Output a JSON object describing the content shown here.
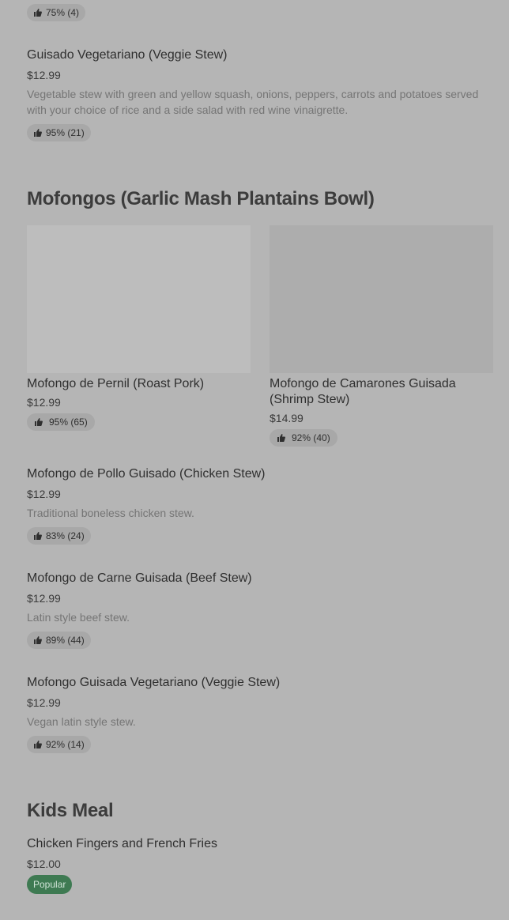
{
  "items": {
    "prev_item": {
      "rating": "75% (4)"
    },
    "guisado_vegetariano": {
      "title": "Guisado Vegetariano (Veggie Stew)",
      "price": "$12.99",
      "description": "Vegetable stew with green and yellow squash, onions, peppers, carrots and potatoes served with your choice of rice and a side salad with red wine vinaigrette.",
      "rating": "95% (21)"
    }
  },
  "mofongos": {
    "heading": "Mofongos (Garlic Mash Plantains Bowl)",
    "cards": [
      {
        "title": "Mofongo de Pernil (Roast Pork)",
        "price": "$12.99",
        "rating": "95% (65)"
      },
      {
        "title": "Mofongo de Camarones Guisada (Shrimp Stew)",
        "price": "$14.99",
        "rating": "92% (40)"
      }
    ],
    "list": [
      {
        "title": "Mofongo de Pollo Guisado (Chicken Stew)",
        "price": "$12.99",
        "description": "Traditional boneless chicken stew.",
        "rating": "83% (24)"
      },
      {
        "title": "Mofongo de Carne Guisada (Beef Stew)",
        "price": "$12.99",
        "description": "Latin style beef stew.",
        "rating": "89% (44)"
      },
      {
        "title": "Mofongo Guisada Vegetariano (Veggie Stew)",
        "price": "$12.99",
        "description": "Vegan latin style stew.",
        "rating": "92% (14)"
      }
    ]
  },
  "kids": {
    "heading": "Kids Meal",
    "item": {
      "title": "Chicken Fingers and French Fries",
      "price": "$12.00",
      "badge": "Popular"
    }
  },
  "colors": {
    "background": "#b5b5b5",
    "image_placeholder_left": "#bdbdbd",
    "image_placeholder_right": "#adadad",
    "rating_pill": "#a8a8a8",
    "popular_badge": "#3e7a52"
  },
  "icons": {
    "rating": "thumbs-up-icon"
  }
}
